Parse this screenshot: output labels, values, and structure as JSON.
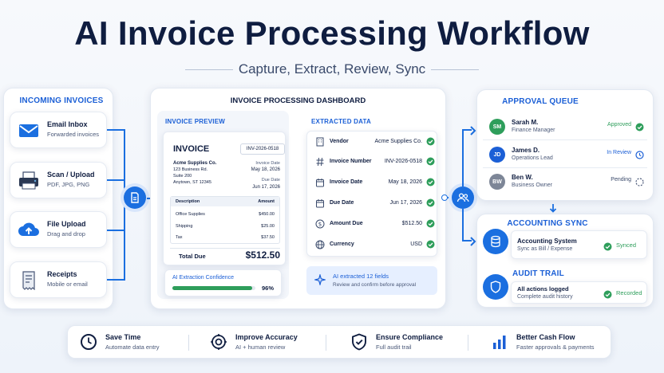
{
  "header": {
    "title": "AI Invoice Processing Workflow",
    "subtitle": "Capture, Extract, Review, Sync"
  },
  "incoming": {
    "heading": "INCOMING INVOICES",
    "items": [
      {
        "title": "Email Inbox",
        "sub": "Forwarded invoices",
        "icon": "envelope-icon"
      },
      {
        "title": "Scan / Upload",
        "sub": "PDF, JPG, PNG",
        "icon": "scanner-icon"
      },
      {
        "title": "File Upload",
        "sub": "Drag and drop",
        "icon": "cloud-upload-icon"
      },
      {
        "title": "Receipts",
        "sub": "Mobile or email",
        "icon": "receipt-icon"
      }
    ]
  },
  "dashboard": {
    "heading": "INVOICE PROCESSING DASHBOARD",
    "preview": {
      "heading": "INVOICE PREVIEW",
      "doc_title": "INVOICE",
      "number": "INV-2026-0518",
      "vendor_name": "Acme Supplies Co.",
      "addr1": "123 Business Rd.",
      "addr2": "Suite 200",
      "addr3": "Anytown, ST 12345",
      "invoice_date_label": "Invoice Date",
      "invoice_date": "May 18, 2026",
      "due_date_label": "Due Date",
      "due_date": "Jun 17, 2026",
      "col_desc": "Description",
      "col_amount": "Amount",
      "lines": [
        {
          "desc": "Office Supplies",
          "amount": "$450.00"
        },
        {
          "desc": "Shipping",
          "amount": "$25.00"
        },
        {
          "desc": "Tax",
          "amount": "$37.50"
        }
      ],
      "total_label": "Total Due",
      "total": "$512.50"
    },
    "confidence": {
      "label": "AI Extraction Confidence",
      "value": "96%",
      "fraction": 0.96
    },
    "extracted": {
      "heading": "EXTRACTED DATA",
      "fields": [
        {
          "label": "Vendor",
          "value": "Acme Supplies Co.",
          "icon": "building-icon"
        },
        {
          "label": "Invoice Number",
          "value": "INV-2026-0518",
          "icon": "hash-icon"
        },
        {
          "label": "Invoice Date",
          "value": "May 18, 2026",
          "icon": "calendar-icon"
        },
        {
          "label": "Due Date",
          "value": "Jun 17, 2026",
          "icon": "calendar-icon"
        },
        {
          "label": "Amount Due",
          "value": "$512.50",
          "icon": "dollar-icon"
        },
        {
          "label": "Currency",
          "value": "USD",
          "icon": "globe-icon"
        }
      ],
      "ai_note_title": "AI extracted 12 fields",
      "ai_note_sub": "Review and confirm before approval"
    }
  },
  "approval": {
    "heading": "APPROVAL QUEUE",
    "rows": [
      {
        "initials": "SM",
        "name": "Sarah M.",
        "role": "Finance Manager",
        "status": "Approved",
        "color": "#2e9e5b",
        "status_color": "#2e9e5b",
        "status_icon": "check-circle-icon"
      },
      {
        "initials": "JD",
        "name": "James D.",
        "role": "Operations Lead",
        "status": "In Review",
        "color": "#1b5fd6",
        "status_color": "#1b5fd6",
        "status_icon": "clock-icon"
      },
      {
        "initials": "BW",
        "name": "Ben W.",
        "role": "Business Owner",
        "status": "Pending",
        "color": "#7d8697",
        "status_color": "#3a4a6b",
        "status_icon": "pending-icon"
      }
    ]
  },
  "accounting": {
    "heading": "ACCOUNTING SYNC",
    "title": "Accounting System",
    "sub": "Sync as Bill / Expense",
    "status": "Synced"
  },
  "audit": {
    "heading": "AUDIT TRAIL",
    "title": "All actions logged",
    "sub": "Complete audit history",
    "status": "Recorded"
  },
  "benefits": [
    {
      "title": "Save Time",
      "sub": "Automate data entry",
      "icon": "clock-icon"
    },
    {
      "title": "Improve Accuracy",
      "sub": "AI + human review",
      "icon": "target-icon"
    },
    {
      "title": "Ensure Compliance",
      "sub": "Full audit trail",
      "icon": "shield-check-icon"
    },
    {
      "title": "Better Cash Flow",
      "sub": "Faster approvals & payments",
      "icon": "bar-chart-icon"
    }
  ],
  "colors": {
    "primary": "#1b6fe0",
    "heading": "#0f1d40",
    "success": "#2e9e5b"
  }
}
